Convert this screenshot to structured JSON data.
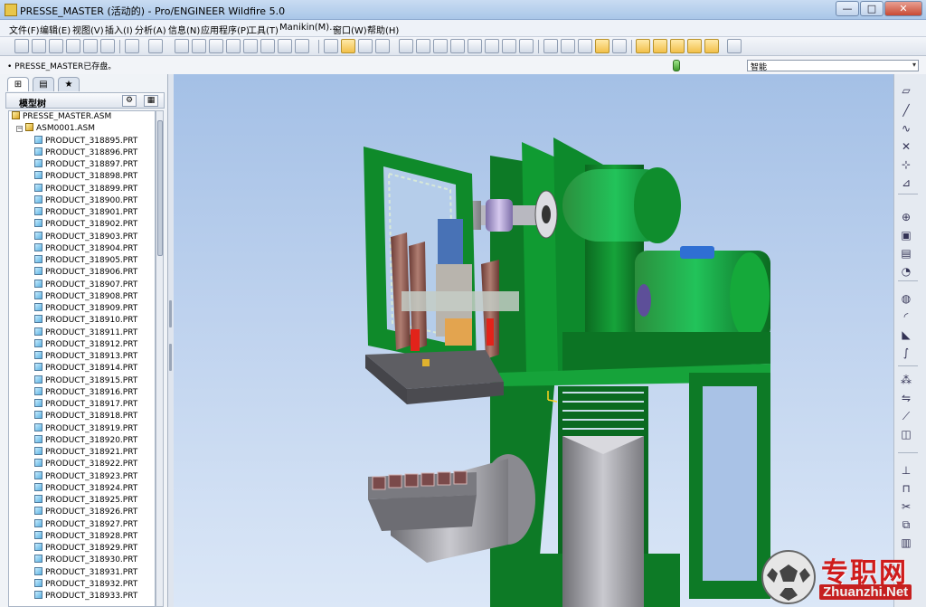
{
  "window": {
    "title": "PRESSE_MASTER (活动的) - Pro/ENGINEER Wildfire 5.0",
    "minimize_label": "—",
    "maximize_label": "□",
    "close_label": "✕"
  },
  "menu": {
    "items": [
      {
        "label": "文件(F)"
      },
      {
        "label": "编辑(E)"
      },
      {
        "label": "视图(V)"
      },
      {
        "label": "插入(I)"
      },
      {
        "label": "分析(A)"
      },
      {
        "label": "信息(N)"
      },
      {
        "label": "应用程序(P)"
      },
      {
        "label": "工具(T)"
      },
      {
        "label": "Manikin(M)..."
      },
      {
        "label": "窗口(W)"
      },
      {
        "label": "帮助(H)"
      }
    ]
  },
  "status": {
    "message": "• PRESSE_MASTER已存盘。"
  },
  "filter": {
    "value": "智能",
    "arrow": "▾"
  },
  "nav": {
    "tabs": [
      {
        "icon": "model-tree-tab-icon",
        "glyph": "⊞"
      },
      {
        "icon": "folder-browser-tab-icon",
        "glyph": "▤"
      },
      {
        "icon": "favorites-tab-icon",
        "glyph": "★"
      }
    ]
  },
  "tree": {
    "header_label": "模型树",
    "settings_glyph": "⚙",
    "show_glyph": "▦",
    "root": "PRESSE_MASTER.ASM",
    "subassembly": "ASM0001.ASM",
    "expand_glyph": "−",
    "parts": [
      "PRODUCT_318895.PRT",
      "PRODUCT_318896.PRT",
      "PRODUCT_318897.PRT",
      "PRODUCT_318898.PRT",
      "PRODUCT_318899.PRT",
      "PRODUCT_318900.PRT",
      "PRODUCT_318901.PRT",
      "PRODUCT_318902.PRT",
      "PRODUCT_318903.PRT",
      "PRODUCT_318904.PRT",
      "PRODUCT_318905.PRT",
      "PRODUCT_318906.PRT",
      "PRODUCT_318907.PRT",
      "PRODUCT_318908.PRT",
      "PRODUCT_318909.PRT",
      "PRODUCT_318910.PRT",
      "PRODUCT_318911.PRT",
      "PRODUCT_318912.PRT",
      "PRODUCT_318913.PRT",
      "PRODUCT_318914.PRT",
      "PRODUCT_318915.PRT",
      "PRODUCT_318916.PRT",
      "PRODUCT_318917.PRT",
      "PRODUCT_318918.PRT",
      "PRODUCT_318919.PRT",
      "PRODUCT_318920.PRT",
      "PRODUCT_318921.PRT",
      "PRODUCT_318922.PRT",
      "PRODUCT_318923.PRT",
      "PRODUCT_318924.PRT",
      "PRODUCT_318925.PRT",
      "PRODUCT_318926.PRT",
      "PRODUCT_318927.PRT",
      "PRODUCT_318928.PRT",
      "PRODUCT_318929.PRT",
      "PRODUCT_318930.PRT",
      "PRODUCT_318931.PRT",
      "PRODUCT_318932.PRT",
      "PRODUCT_318933.PRT"
    ]
  },
  "colors": {
    "machine_green": "#0f8a2a",
    "viewport_top": "#a4c0e6",
    "viewport_bottom": "#dbe7f7"
  },
  "right_toolbar": {
    "icons": [
      {
        "name": "datum-plane-icon",
        "glyph": "▱"
      },
      {
        "name": "datum-axis-icon",
        "glyph": "╱"
      },
      {
        "name": "datum-curve-icon",
        "glyph": "∿"
      },
      {
        "name": "datum-point-icon",
        "glyph": "✕"
      },
      {
        "name": "coordinate-system-icon",
        "glyph": "⊹"
      },
      {
        "name": "analysis-feature-icon",
        "glyph": "⊿"
      },
      {
        "name": "add-component-icon",
        "glyph": "⊕"
      },
      {
        "name": "create-component-icon",
        "glyph": "▣"
      },
      {
        "name": "extrude-icon",
        "glyph": "▤"
      },
      {
        "name": "revolve-icon",
        "glyph": "◔"
      },
      {
        "name": "hole-icon",
        "glyph": "◍"
      },
      {
        "name": "round-icon",
        "glyph": "◜"
      },
      {
        "name": "chamfer-icon",
        "glyph": "◣"
      },
      {
        "name": "sweep-icon",
        "glyph": "∫"
      },
      {
        "name": "pattern-icon",
        "glyph": "⁂"
      },
      {
        "name": "mirror-icon",
        "glyph": "⇋"
      },
      {
        "name": "draft-icon",
        "glyph": "⟋"
      },
      {
        "name": "shell-icon",
        "glyph": "◫"
      },
      {
        "name": "rib-icon",
        "glyph": "⊥"
      },
      {
        "name": "merge-icon",
        "glyph": "⊓"
      },
      {
        "name": "trim-icon",
        "glyph": "✂"
      },
      {
        "name": "offset-icon",
        "glyph": "⧉"
      },
      {
        "name": "thicken-icon",
        "glyph": "▥"
      }
    ]
  },
  "watermark": {
    "cn": "专职网",
    "en": "Zhuanzhi.Net"
  }
}
